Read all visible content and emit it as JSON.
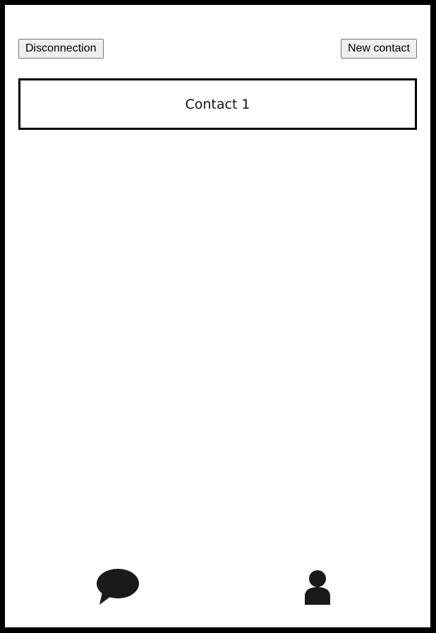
{
  "header": {
    "disconnect_label": "Disconnection",
    "new_contact_label": "New contact"
  },
  "contacts": [
    {
      "name": "Contact 1"
    }
  ],
  "nav": {
    "chat_icon": "speech-bubble-icon",
    "profile_icon": "user-icon"
  },
  "colors": {
    "frame": "#000000",
    "background": "#ffffff",
    "icon": "#1a1a1a",
    "button_bg": "#efefef",
    "button_border": "#767676"
  }
}
